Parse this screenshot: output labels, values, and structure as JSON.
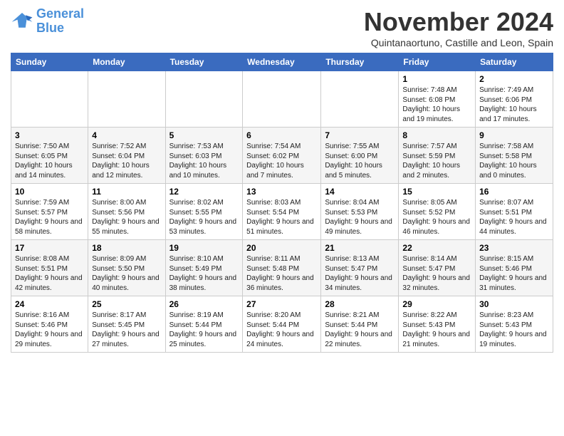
{
  "logo": {
    "line1": "General",
    "line2": "Blue"
  },
  "title": "November 2024",
  "location": "Quintanaortuno, Castille and Leon, Spain",
  "days_header": [
    "Sunday",
    "Monday",
    "Tuesday",
    "Wednesday",
    "Thursday",
    "Friday",
    "Saturday"
  ],
  "weeks": [
    [
      {
        "day": "",
        "info": ""
      },
      {
        "day": "",
        "info": ""
      },
      {
        "day": "",
        "info": ""
      },
      {
        "day": "",
        "info": ""
      },
      {
        "day": "",
        "info": ""
      },
      {
        "day": "1",
        "info": "Sunrise: 7:48 AM\nSunset: 6:08 PM\nDaylight: 10 hours and 19 minutes."
      },
      {
        "day": "2",
        "info": "Sunrise: 7:49 AM\nSunset: 6:06 PM\nDaylight: 10 hours and 17 minutes."
      }
    ],
    [
      {
        "day": "3",
        "info": "Sunrise: 7:50 AM\nSunset: 6:05 PM\nDaylight: 10 hours and 14 minutes."
      },
      {
        "day": "4",
        "info": "Sunrise: 7:52 AM\nSunset: 6:04 PM\nDaylight: 10 hours and 12 minutes."
      },
      {
        "day": "5",
        "info": "Sunrise: 7:53 AM\nSunset: 6:03 PM\nDaylight: 10 hours and 10 minutes."
      },
      {
        "day": "6",
        "info": "Sunrise: 7:54 AM\nSunset: 6:02 PM\nDaylight: 10 hours and 7 minutes."
      },
      {
        "day": "7",
        "info": "Sunrise: 7:55 AM\nSunset: 6:00 PM\nDaylight: 10 hours and 5 minutes."
      },
      {
        "day": "8",
        "info": "Sunrise: 7:57 AM\nSunset: 5:59 PM\nDaylight: 10 hours and 2 minutes."
      },
      {
        "day": "9",
        "info": "Sunrise: 7:58 AM\nSunset: 5:58 PM\nDaylight: 10 hours and 0 minutes."
      }
    ],
    [
      {
        "day": "10",
        "info": "Sunrise: 7:59 AM\nSunset: 5:57 PM\nDaylight: 9 hours and 58 minutes."
      },
      {
        "day": "11",
        "info": "Sunrise: 8:00 AM\nSunset: 5:56 PM\nDaylight: 9 hours and 55 minutes."
      },
      {
        "day": "12",
        "info": "Sunrise: 8:02 AM\nSunset: 5:55 PM\nDaylight: 9 hours and 53 minutes."
      },
      {
        "day": "13",
        "info": "Sunrise: 8:03 AM\nSunset: 5:54 PM\nDaylight: 9 hours and 51 minutes."
      },
      {
        "day": "14",
        "info": "Sunrise: 8:04 AM\nSunset: 5:53 PM\nDaylight: 9 hours and 49 minutes."
      },
      {
        "day": "15",
        "info": "Sunrise: 8:05 AM\nSunset: 5:52 PM\nDaylight: 9 hours and 46 minutes."
      },
      {
        "day": "16",
        "info": "Sunrise: 8:07 AM\nSunset: 5:51 PM\nDaylight: 9 hours and 44 minutes."
      }
    ],
    [
      {
        "day": "17",
        "info": "Sunrise: 8:08 AM\nSunset: 5:51 PM\nDaylight: 9 hours and 42 minutes."
      },
      {
        "day": "18",
        "info": "Sunrise: 8:09 AM\nSunset: 5:50 PM\nDaylight: 9 hours and 40 minutes."
      },
      {
        "day": "19",
        "info": "Sunrise: 8:10 AM\nSunset: 5:49 PM\nDaylight: 9 hours and 38 minutes."
      },
      {
        "day": "20",
        "info": "Sunrise: 8:11 AM\nSunset: 5:48 PM\nDaylight: 9 hours and 36 minutes."
      },
      {
        "day": "21",
        "info": "Sunrise: 8:13 AM\nSunset: 5:47 PM\nDaylight: 9 hours and 34 minutes."
      },
      {
        "day": "22",
        "info": "Sunrise: 8:14 AM\nSunset: 5:47 PM\nDaylight: 9 hours and 32 minutes."
      },
      {
        "day": "23",
        "info": "Sunrise: 8:15 AM\nSunset: 5:46 PM\nDaylight: 9 hours and 31 minutes."
      }
    ],
    [
      {
        "day": "24",
        "info": "Sunrise: 8:16 AM\nSunset: 5:46 PM\nDaylight: 9 hours and 29 minutes."
      },
      {
        "day": "25",
        "info": "Sunrise: 8:17 AM\nSunset: 5:45 PM\nDaylight: 9 hours and 27 minutes."
      },
      {
        "day": "26",
        "info": "Sunrise: 8:19 AM\nSunset: 5:44 PM\nDaylight: 9 hours and 25 minutes."
      },
      {
        "day": "27",
        "info": "Sunrise: 8:20 AM\nSunset: 5:44 PM\nDaylight: 9 hours and 24 minutes."
      },
      {
        "day": "28",
        "info": "Sunrise: 8:21 AM\nSunset: 5:44 PM\nDaylight: 9 hours and 22 minutes."
      },
      {
        "day": "29",
        "info": "Sunrise: 8:22 AM\nSunset: 5:43 PM\nDaylight: 9 hours and 21 minutes."
      },
      {
        "day": "30",
        "info": "Sunrise: 8:23 AM\nSunset: 5:43 PM\nDaylight: 9 hours and 19 minutes."
      }
    ]
  ]
}
